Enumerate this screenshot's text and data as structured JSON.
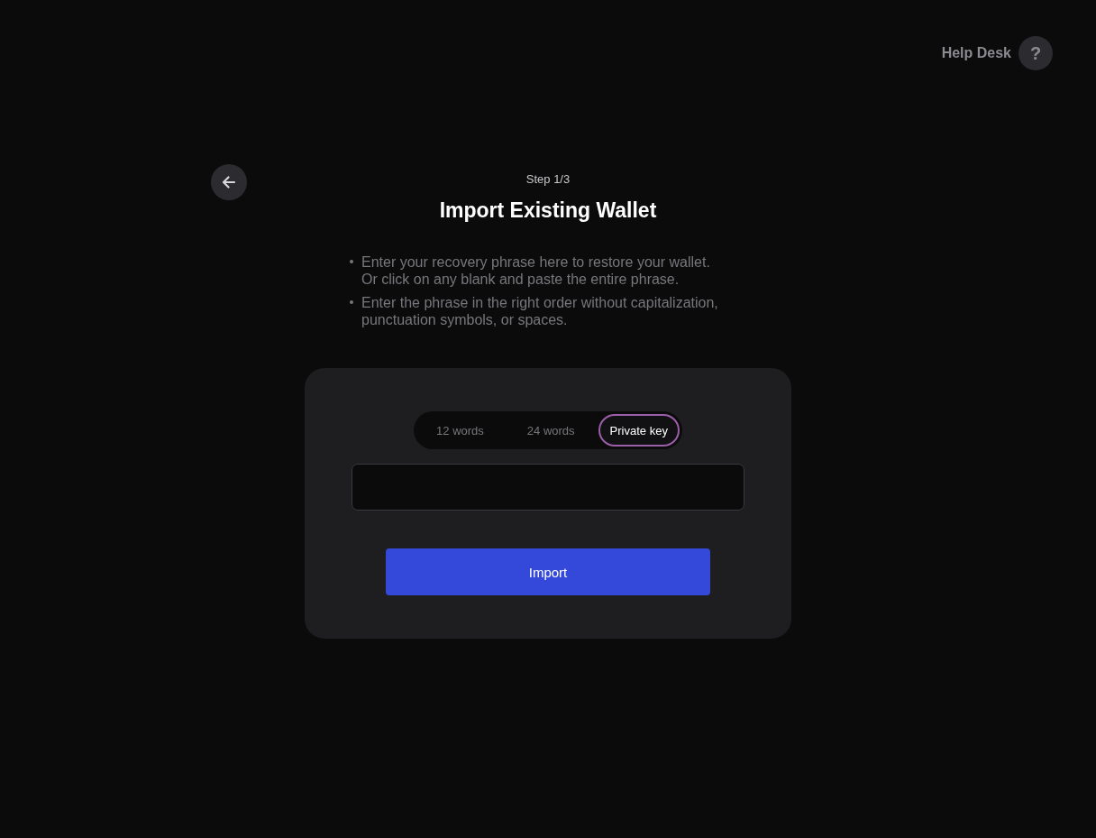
{
  "help": {
    "label": "Help Desk",
    "icon": "?"
  },
  "step": "Step 1/3",
  "title": "Import Existing Wallet",
  "instructions": [
    "Enter your recovery phrase here to restore your wallet. Or click on any blank and paste the entire phrase.",
    "Enter the phrase in the right order without capitalization, punctuation symbols, or spaces."
  ],
  "tabs": [
    {
      "label": "12 words",
      "selected": false
    },
    {
      "label": "24 words",
      "selected": false
    },
    {
      "label": "Private key",
      "selected": true
    }
  ],
  "import_button": "Import"
}
